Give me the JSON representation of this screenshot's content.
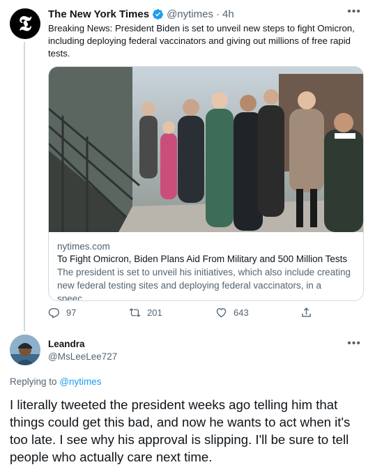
{
  "original_tweet": {
    "avatar_glyph": "𝕿",
    "author_name": "The New York Times",
    "handle": "@nytimes",
    "separator": "·",
    "time": "4h",
    "text": "Breaking News: President Biden is set to unveil new steps to fight Omicron, including deploying federal vaccinators and giving out millions of free rapid tests.",
    "card": {
      "domain": "nytimes.com",
      "title": "To Fight Omicron, Biden Plans Aid From Military and 500 Million Tests",
      "description": "The president is set to unveil his initiatives, which also include creating new federal testing sites and deploying federal vaccinators, in a speec..."
    },
    "actions": {
      "replies": "97",
      "retweets": "201",
      "likes": "643"
    },
    "colors": {
      "verified": "#1d9bf0",
      "secondary_text": "#536471"
    }
  },
  "reply_tweet": {
    "author_name": "Leandra",
    "handle": "@MsLeeLee727",
    "replying_prefix": "Replying to",
    "replying_to": "@nytimes",
    "text": "I literally tweeted the president weeks ago telling him that things could get this bad, and now he wants to act when it's too late. I see why his approval is slipping. I'll be sure to tell people who actually care next time.",
    "colors": {
      "link": "#1d9bf0"
    }
  },
  "icons": [
    "verified-icon",
    "more-icon",
    "reply-icon",
    "retweet-icon",
    "like-icon",
    "share-icon"
  ]
}
